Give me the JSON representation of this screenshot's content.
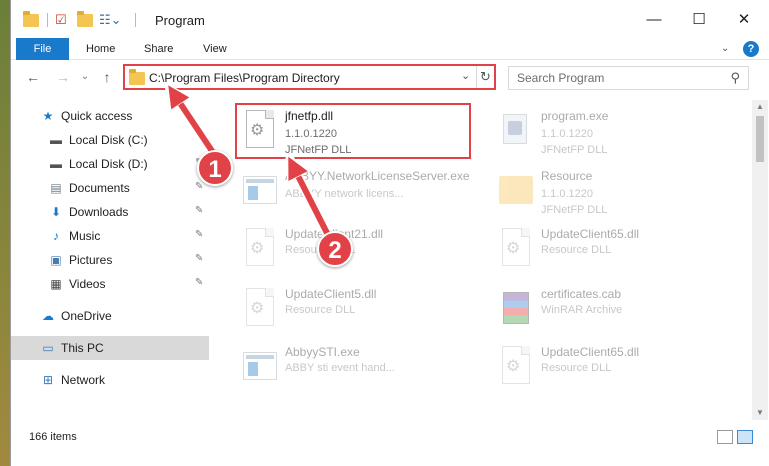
{
  "window": {
    "title": "Program",
    "controls": [
      "—",
      "☐",
      "✕"
    ]
  },
  "ribbon": {
    "file": "File",
    "home": "Home",
    "share": "Share",
    "view": "View",
    "help": "?"
  },
  "address": {
    "path": "C:\\Program Files\\Program Directory",
    "dropdown": "⌄",
    "refresh": "↻"
  },
  "search": {
    "placeholder": "Search Program",
    "icon": "search-icon"
  },
  "nav": {
    "back": "←",
    "forward": "→",
    "recent": "⌄",
    "up": "↑"
  },
  "sidebar": {
    "items": [
      {
        "label": "Quick access",
        "icon": "star-icon"
      },
      {
        "label": "Local Disk (C:)",
        "icon": "drive-icon"
      },
      {
        "label": "Local Disk (D:)",
        "icon": "drive-icon"
      },
      {
        "label": "Documents",
        "icon": "documents-icon"
      },
      {
        "label": "Downloads",
        "icon": "download-icon"
      },
      {
        "label": "Music",
        "icon": "music-icon"
      },
      {
        "label": "Pictures",
        "icon": "pictures-icon"
      },
      {
        "label": "Videos",
        "icon": "videos-icon"
      },
      {
        "label": "OneDrive",
        "icon": "cloud-icon"
      },
      {
        "label": "This PC",
        "icon": "computer-icon"
      },
      {
        "label": "Network",
        "icon": "network-icon"
      }
    ]
  },
  "files": [
    {
      "name": "jfnetfp.dll",
      "line2": "1.1.0.1220",
      "line3": "JFNetFP DLL",
      "icon": "dll-icon"
    },
    {
      "name": "program.exe",
      "line2": "1.1.0.1220",
      "line3": "JFNetFP DLL",
      "icon": "program-exe-icon"
    },
    {
      "name": "ABBYY.NetworkLicenseServer.exe",
      "line2": "ABBYY network licens...",
      "line3": "",
      "icon": "exe-icon"
    },
    {
      "name": "Resource",
      "line2": "1.1.0.1220",
      "line3": "JFNetFP DLL",
      "icon": "folder-icon"
    },
    {
      "name": "UpdateClient21.dll",
      "line2": "Resource DLL",
      "line3": "",
      "icon": "dll-icon"
    },
    {
      "name": "UpdateClient65.dll",
      "line2": "Resource DLL",
      "line3": "",
      "icon": "dll-icon"
    },
    {
      "name": "UpdateClient5.dll",
      "line2": "Resource DLL",
      "line3": "",
      "icon": "dll-icon"
    },
    {
      "name": "certificates.cab",
      "line2": "WinRAR Archive",
      "line3": "",
      "icon": "archive-icon"
    },
    {
      "name": "AbbyySTI.exe",
      "line2": "ABBY sti event hand...",
      "line3": "",
      "icon": "exe-icon"
    },
    {
      "name": "UpdateClient65.dll",
      "line2": "Resource DLL",
      "line3": "",
      "icon": "dll-icon"
    }
  ],
  "status": {
    "items": "166 items"
  },
  "annotations": {
    "badge1": "1",
    "badge2": "2",
    "color": "#e14248"
  },
  "colors": {
    "accent": "#1979ca",
    "highlight": "#e14248",
    "selected": "#d9d9d9"
  }
}
